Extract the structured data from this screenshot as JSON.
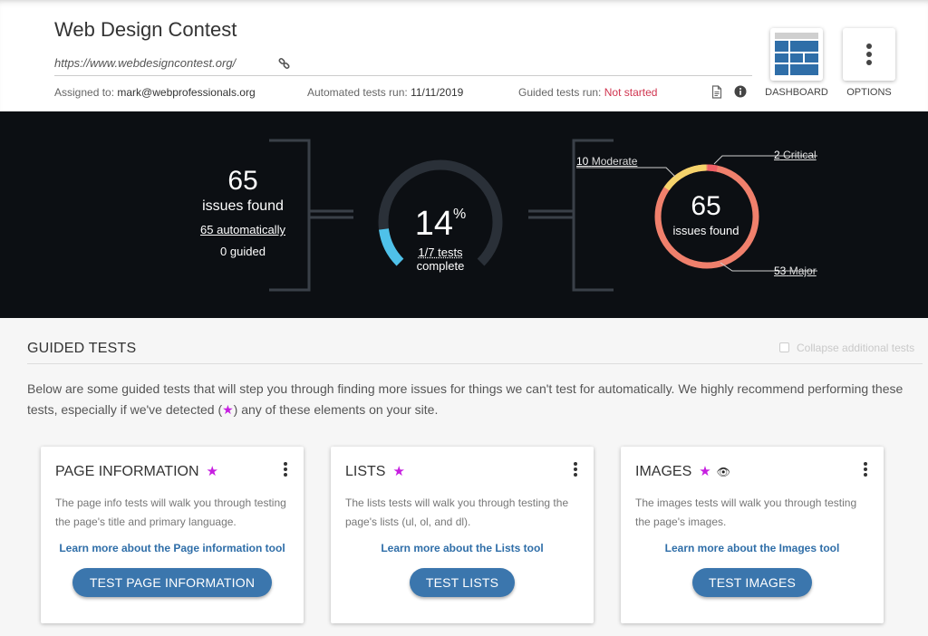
{
  "header": {
    "title": "Web Design Contest",
    "url": "https://www.webdesigncontest.org/",
    "assigned_label": "Assigned to:",
    "assigned_value": "mark@webprofessionals.org",
    "automated_label": "Automated tests run:",
    "automated_value": "11/11/2019",
    "guided_label": "Guided tests run:",
    "guided_value": "Not started",
    "dashboard_label": "DASHBOARD",
    "options_label": "OPTIONS"
  },
  "summary": {
    "issues_total": "65",
    "issues_label": "issues found",
    "automatic_link": "65 automatically",
    "guided_count": "0",
    "guided_label": "guided",
    "percent": "14",
    "percent_sign": "%",
    "progress_fraction": 0.14,
    "tests_link": "1/7 tests",
    "complete_label": "complete",
    "donut_total": "65",
    "donut_label": "issues found",
    "severity": {
      "moderate_count": "10",
      "moderate_label": "Moderate",
      "critical_count": "2",
      "critical_label": "Critical",
      "major_count": "53",
      "major_label": "Major"
    },
    "colors": {
      "critical": "#ef5f66",
      "moderate": "#f5d36b",
      "major": "#f0806c",
      "progress": "#4fc1e9",
      "track": "#2a3038"
    }
  },
  "guided": {
    "title": "GUIDED TESTS",
    "collapse_label": "Collapse additional tests",
    "intro_before": "Below are some guided tests that will step you through finding more issues for things we can't test for automatically. We highly recommend performing these tests, especially if we've detected (",
    "intro_after": ") any of these elements on your site.",
    "cards": [
      {
        "title": "PAGE INFORMATION",
        "description": "The page info tests will walk you through testing the page's title and primary language.",
        "link": "Learn more about the Page information tool",
        "button": "TEST PAGE INFORMATION"
      },
      {
        "title": "LISTS",
        "description": "The lists tests will walk you through testing the page's lists (ul, ol, and dl).",
        "link": "Learn more about the Lists tool",
        "button": "TEST LISTS"
      },
      {
        "title": "IMAGES",
        "description": "The images tests will walk you through testing the page's images.",
        "link": "Learn more about the Images tool",
        "button": "TEST IMAGES"
      }
    ]
  }
}
